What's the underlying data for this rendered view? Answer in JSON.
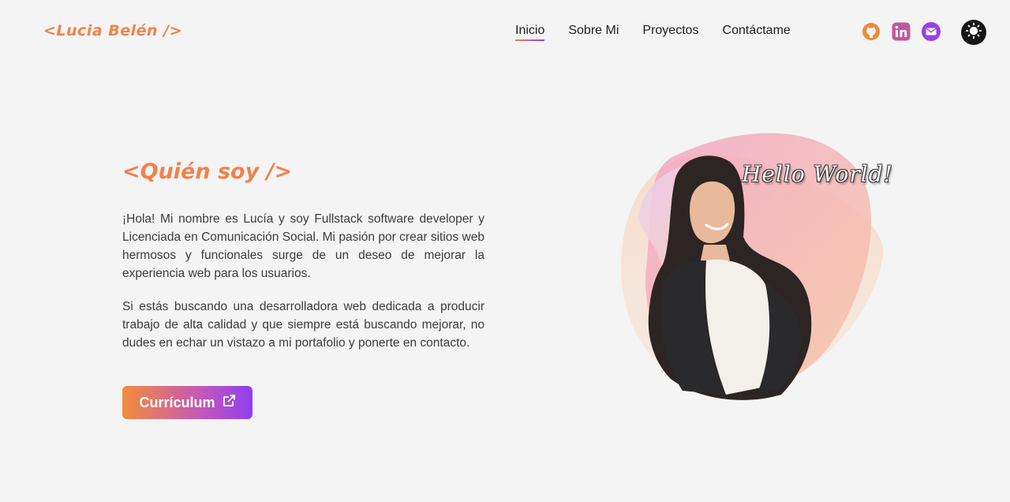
{
  "brand": {
    "logo_text": "<Lucia Belén />"
  },
  "nav": {
    "items": [
      {
        "label": "Inicio",
        "active": true
      },
      {
        "label": "Sobre Mi",
        "active": false
      },
      {
        "label": "Proyectos",
        "active": false
      },
      {
        "label": "Contáctame",
        "active": false
      }
    ]
  },
  "social": {
    "icons": [
      "github-icon",
      "linkedin-icon",
      "mail-icon"
    ],
    "theme_toggle_icon": "sun-icon"
  },
  "about": {
    "title": "<Quién soy />",
    "paragraph_1": "¡Hola! Mi nombre es Lucía y soy Fullstack software developer y Licenciada en Comunicación Social. Mi pasión por crear sitios web hermosos y funcionales surge de un deseo de mejorar la experiencia web para los usuarios.",
    "paragraph_2": "Si estás buscando una desarrolladora web dedicada a producir trabajo de alta calidad y que siempre está buscando mejorar, no dudes en echar un vistazo a mi portafolio y ponerte en contacto.",
    "cv_button_label": "Currículum",
    "cv_button_icon": "external-link-icon"
  },
  "hero": {
    "overlay_text": "Hello World!"
  },
  "colors": {
    "accent_orange": "#f0824a",
    "accent_purple": "#8e3ff2",
    "background": "#f4f4f4",
    "linkedin": "#c0579e"
  }
}
